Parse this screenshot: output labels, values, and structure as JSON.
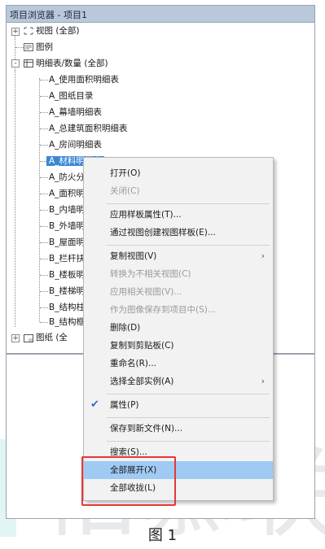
{
  "panel": {
    "title": "项目浏览器 - 项目1"
  },
  "tree": [
    {
      "label": "视图 (全部)",
      "expander": "+"
    },
    {
      "label": "图例"
    },
    {
      "label": "明细表/数量 (全部)",
      "expander": "-"
    },
    {
      "label": "A_使用面积明细表"
    },
    {
      "label": "A_图纸目录"
    },
    {
      "label": "A_幕墙明细表"
    },
    {
      "label": "A_总建筑面积明细表"
    },
    {
      "label": "A_房间明细表"
    },
    {
      "label": "A_材料明细表"
    },
    {
      "label": "A_防火分"
    },
    {
      "label": "A_面积明"
    },
    {
      "label": "B_内墙明"
    },
    {
      "label": "B_外墙明"
    },
    {
      "label": "B_屋面明"
    },
    {
      "label": "B_栏杆扶"
    },
    {
      "label": "B_楼板明"
    },
    {
      "label": "B_楼梯明"
    },
    {
      "label": "B_结构柱"
    },
    {
      "label": "B_结构框"
    },
    {
      "label": "图纸 (全",
      "expander": "+"
    }
  ],
  "context_menu": [
    {
      "label": "打开(O)",
      "enabled": true
    },
    {
      "label": "关闭(C)",
      "enabled": false
    },
    {
      "label": "应用样板属性(T)...",
      "enabled": true
    },
    {
      "label": "通过视图创建视图样板(E)...",
      "enabled": true
    },
    {
      "label": "复制视图(V)",
      "enabled": true,
      "submenu": true
    },
    {
      "label": "转换为不相关视图(C)",
      "enabled": false
    },
    {
      "label": "应用相关视图(V)...",
      "enabled": false
    },
    {
      "label": "作为图像保存到项目中(S)...",
      "enabled": false
    },
    {
      "label": "删除(D)",
      "enabled": true
    },
    {
      "label": "复制到剪贴板(C)",
      "enabled": true
    },
    {
      "label": "重命名(R)...",
      "enabled": true
    },
    {
      "label": "选择全部实例(A)",
      "enabled": true,
      "submenu": true
    },
    {
      "label": "属性(P)",
      "enabled": true,
      "checked": true
    },
    {
      "label": "保存到新文件(N)...",
      "enabled": true
    },
    {
      "label": "搜索(S)...",
      "enabled": true
    },
    {
      "label": "全部展开(X)",
      "enabled": true,
      "highlighted": true
    },
    {
      "label": "全部收拢(L)",
      "enabled": true
    }
  ],
  "submenu_arrow": "›",
  "check_mark": "✔",
  "caption": "图 1",
  "watermark": "柏慕联",
  "colors": {
    "selection": "#3c86d6",
    "menu_highlight": "#9fcaf3",
    "annotation_box": "#e53935"
  }
}
